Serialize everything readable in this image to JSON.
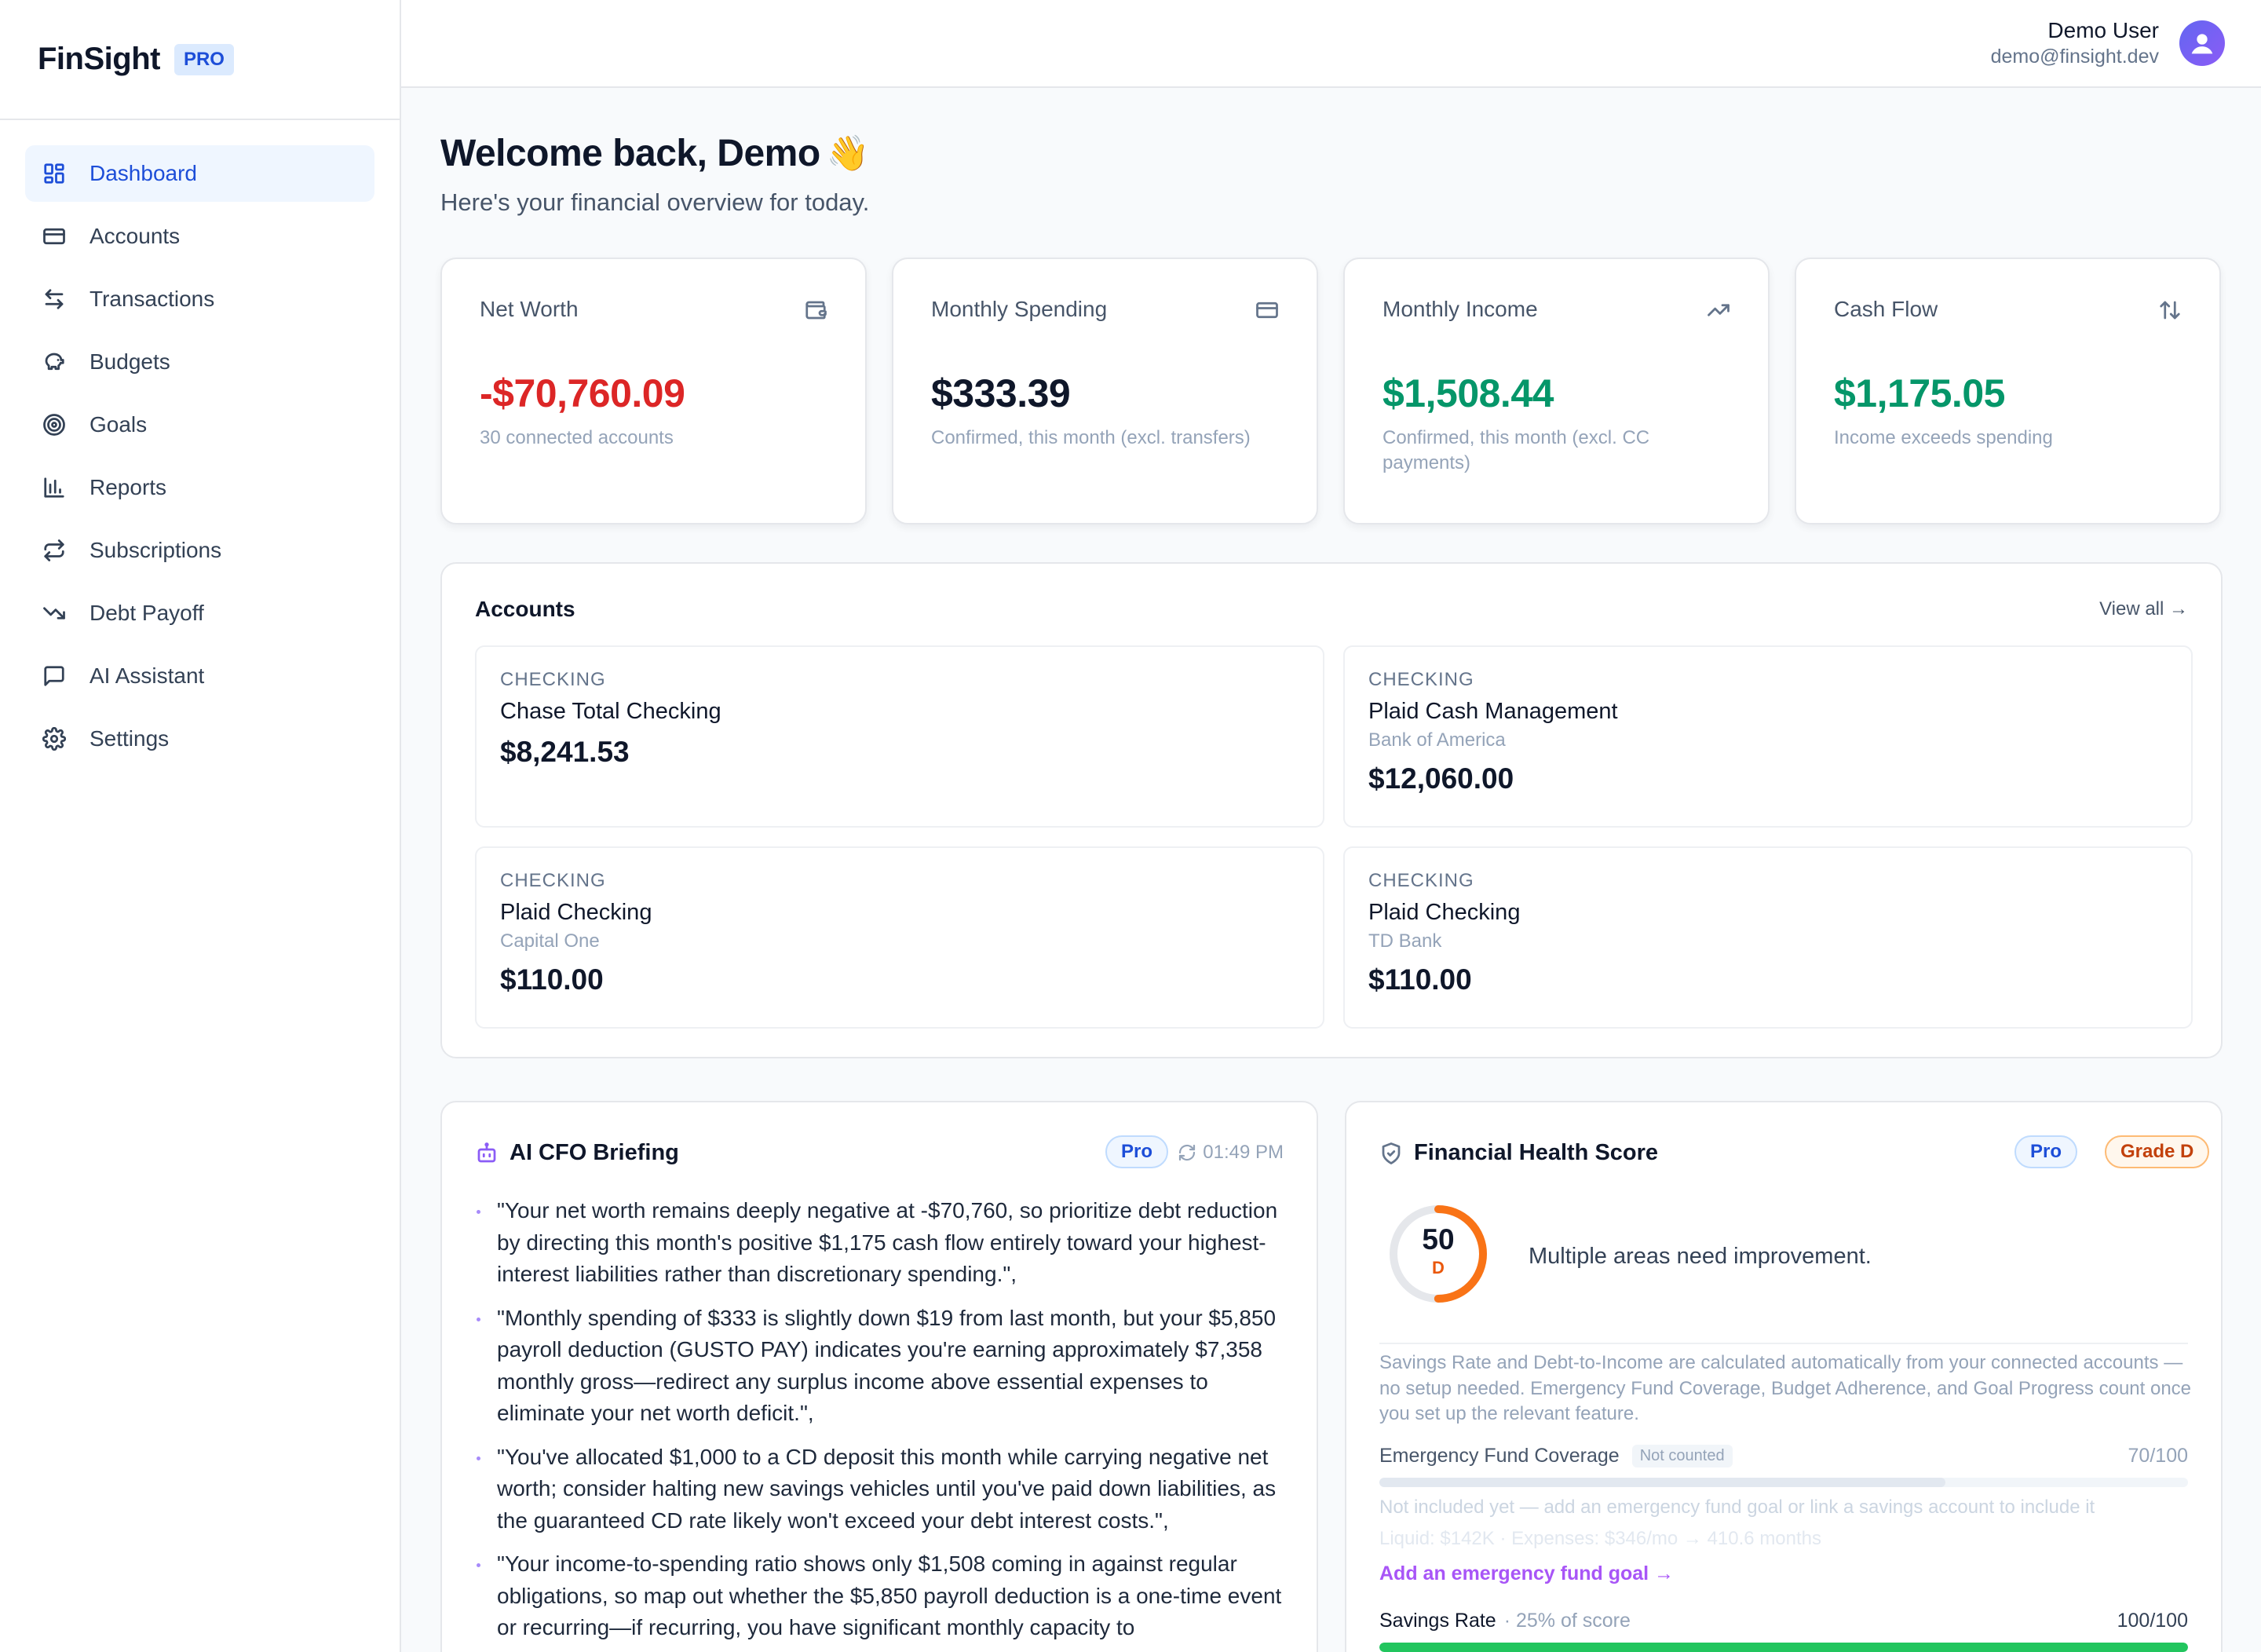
{
  "brand": {
    "name": "FinSight",
    "badge": "PRO"
  },
  "user": {
    "name": "Demo User",
    "email": "demo@finsight.dev"
  },
  "nav": [
    {
      "label": "Dashboard",
      "icon": "grid-icon",
      "active": true
    },
    {
      "label": "Accounts",
      "icon": "credit-card-icon"
    },
    {
      "label": "Transactions",
      "icon": "swap-arrows-icon"
    },
    {
      "label": "Budgets",
      "icon": "piggy-bank-icon"
    },
    {
      "label": "Goals",
      "icon": "target-icon"
    },
    {
      "label": "Reports",
      "icon": "bar-chart-icon"
    },
    {
      "label": "Subscriptions",
      "icon": "repeat-icon"
    },
    {
      "label": "Debt Payoff",
      "icon": "trending-down-icon"
    },
    {
      "label": "AI Assistant",
      "icon": "message-square-icon"
    },
    {
      "label": "Settings",
      "icon": "gear-icon"
    }
  ],
  "header": {
    "title": "Welcome back, Demo",
    "emoji": "👋",
    "subtitle": "Here's your financial overview for today."
  },
  "stats": [
    {
      "title": "Net Worth",
      "value": "-$70,760.09",
      "note": "30 connected accounts",
      "icon": "wallet-icon",
      "color": "#dc2626"
    },
    {
      "title": "Monthly Spending",
      "value": "$333.39",
      "note": "Confirmed, this month (excl. transfers)",
      "icon": "credit-card-icon",
      "color": "#0f172a"
    },
    {
      "title": "Monthly Income",
      "value": "$1,508.44",
      "note": "Confirmed, this month (excl. CC payments)",
      "icon": "trending-up-icon",
      "color": "#059669"
    },
    {
      "title": "Cash Flow",
      "value": "$1,175.05",
      "note": "Income exceeds spending",
      "icon": "arrow-up-down-icon",
      "color": "#059669"
    }
  ],
  "accounts": {
    "title": "Accounts",
    "view_all": "View all →",
    "items": [
      {
        "type": "CHECKING",
        "name": "Chase Total Checking",
        "bank": "",
        "balance": "$8,241.53"
      },
      {
        "type": "CHECKING",
        "name": "Plaid Cash Management",
        "bank": "Bank of America",
        "balance": "$12,060.00"
      },
      {
        "type": "CHECKING",
        "name": "Plaid Checking",
        "bank": "Capital One",
        "balance": "$110.00"
      },
      {
        "type": "CHECKING",
        "name": "Plaid Checking",
        "bank": "TD Bank",
        "balance": "$110.00"
      }
    ]
  },
  "briefing": {
    "title": "AI CFO Briefing",
    "badge": "Pro",
    "time": "01:49 PM",
    "bullets": [
      "\"Your net worth remains deeply negative at -$70,760, so prioritize debt reduction by directing this month's positive $1,175 cash flow entirely toward your highest-interest liabilities rather than discretionary spending.\",",
      "\"Monthly spending of $333 is slightly down $19 from last month, but your $5,850 payroll deduction (GUSTO PAY) indicates you're earning approximately $7,358 monthly gross—redirect any surplus income above essential expenses to eliminate your net worth deficit.\",",
      "\"You've allocated $1,000 to a CD deposit this month while carrying negative net worth; consider halting new savings vehicles until you've paid down liabilities, as the guaranteed CD rate likely won't exceed your debt interest costs.\",",
      "\"Your income-to-spending ratio shows only $1,508 coming in against regular obligations, so map out whether the $5,850 payroll deduction is a one-time event or recurring—if recurring, you have significant monthly capacity to"
    ]
  },
  "health": {
    "title": "Financial Health Score",
    "badge": "Pro",
    "grade_badge": "Grade D",
    "score": "50",
    "score_value": 50,
    "grade": "D",
    "message": "Multiple areas need improvement.",
    "description": "Savings Rate and Debt-to-Income are calculated automatically from your connected accounts — no setup needed. Emergency Fund Coverage, Budget Adherence, and Goal Progress count once you set up the relevant feature.",
    "emergency": {
      "label": "Emergency Fund Coverage",
      "tag": "Not counted",
      "score": "70/100",
      "fill": 70,
      "note": "Not included yet — add an emergency fund goal or link a savings account to include it",
      "detail": "Liquid: $142K · Expenses: $346/mo → 410.6 months",
      "link": "Add an emergency fund goal →"
    },
    "savings": {
      "label": "Savings Rate",
      "weight": "· 25% of score",
      "score": "100/100",
      "fill": 100
    }
  }
}
